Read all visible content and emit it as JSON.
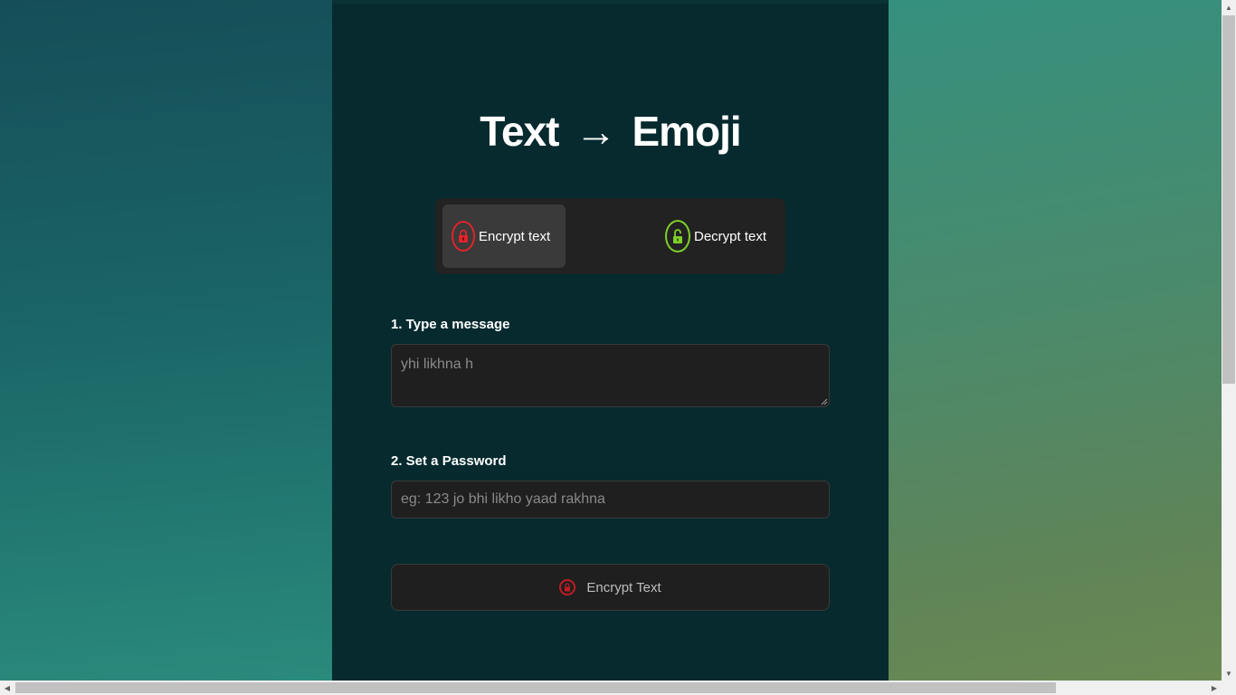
{
  "header": {
    "title_left": "Text",
    "title_arrow": "→",
    "title_right": "Emoji"
  },
  "mode_toggle": {
    "encrypt_label": "Encrypt text",
    "decrypt_label": "Decrypt text",
    "selected": "encrypt"
  },
  "form": {
    "message_label": "1. Type a message",
    "message_placeholder": "yhi likhna h",
    "password_label": "2. Set a Password",
    "password_placeholder": "eg: 123 jo bhi likho yaad rakhna",
    "submit_label": "Encrypt Text"
  },
  "icons": {
    "encrypt": "lock-closed-icon",
    "decrypt": "lock-open-icon",
    "submit": "lock-closed-icon"
  },
  "colors": {
    "card_bg": "#062a2e",
    "encrypt_accent": "#e0242b",
    "decrypt_accent": "#7fd02a",
    "field_bg": "#1f1f1f"
  }
}
